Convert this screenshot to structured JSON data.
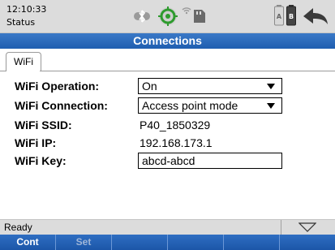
{
  "status_bar": {
    "time": "12:10:33",
    "label": "Status",
    "icons": [
      "bluetooth-icon",
      "gps-icon",
      "wifi-signal-icon",
      "sd-card-icon",
      "battery-a-icon",
      "battery-b-icon",
      "back-arrow-icon"
    ],
    "battery_a_label": "A",
    "battery_b_label": "B"
  },
  "title": "Connections",
  "tabs": [
    {
      "label": "WiFi",
      "active": true
    }
  ],
  "form": {
    "operation": {
      "label": "WiFi Operation:",
      "value": "On"
    },
    "connection": {
      "label": "WiFi Connection:",
      "value": "Access point mode"
    },
    "ssid": {
      "label": "WiFi SSID:",
      "value": "P40_1850329"
    },
    "ip": {
      "label": "WiFi IP:",
      "value": "192.168.173.1"
    },
    "key": {
      "label": "WiFi Key:",
      "value": "abcd-abcd"
    }
  },
  "footer": {
    "status_text": "Ready"
  },
  "softkeys": [
    {
      "label": "Cont",
      "enabled": true
    },
    {
      "label": "Set",
      "enabled": false
    },
    {
      "label": "",
      "enabled": false
    },
    {
      "label": "",
      "enabled": false
    },
    {
      "label": "",
      "enabled": false
    },
    {
      "label": "",
      "enabled": false
    }
  ],
  "colors": {
    "accent": "#1f5eb0",
    "statusbar_bg": "#dcdcdc",
    "gps_green": "#2e9b2e"
  }
}
